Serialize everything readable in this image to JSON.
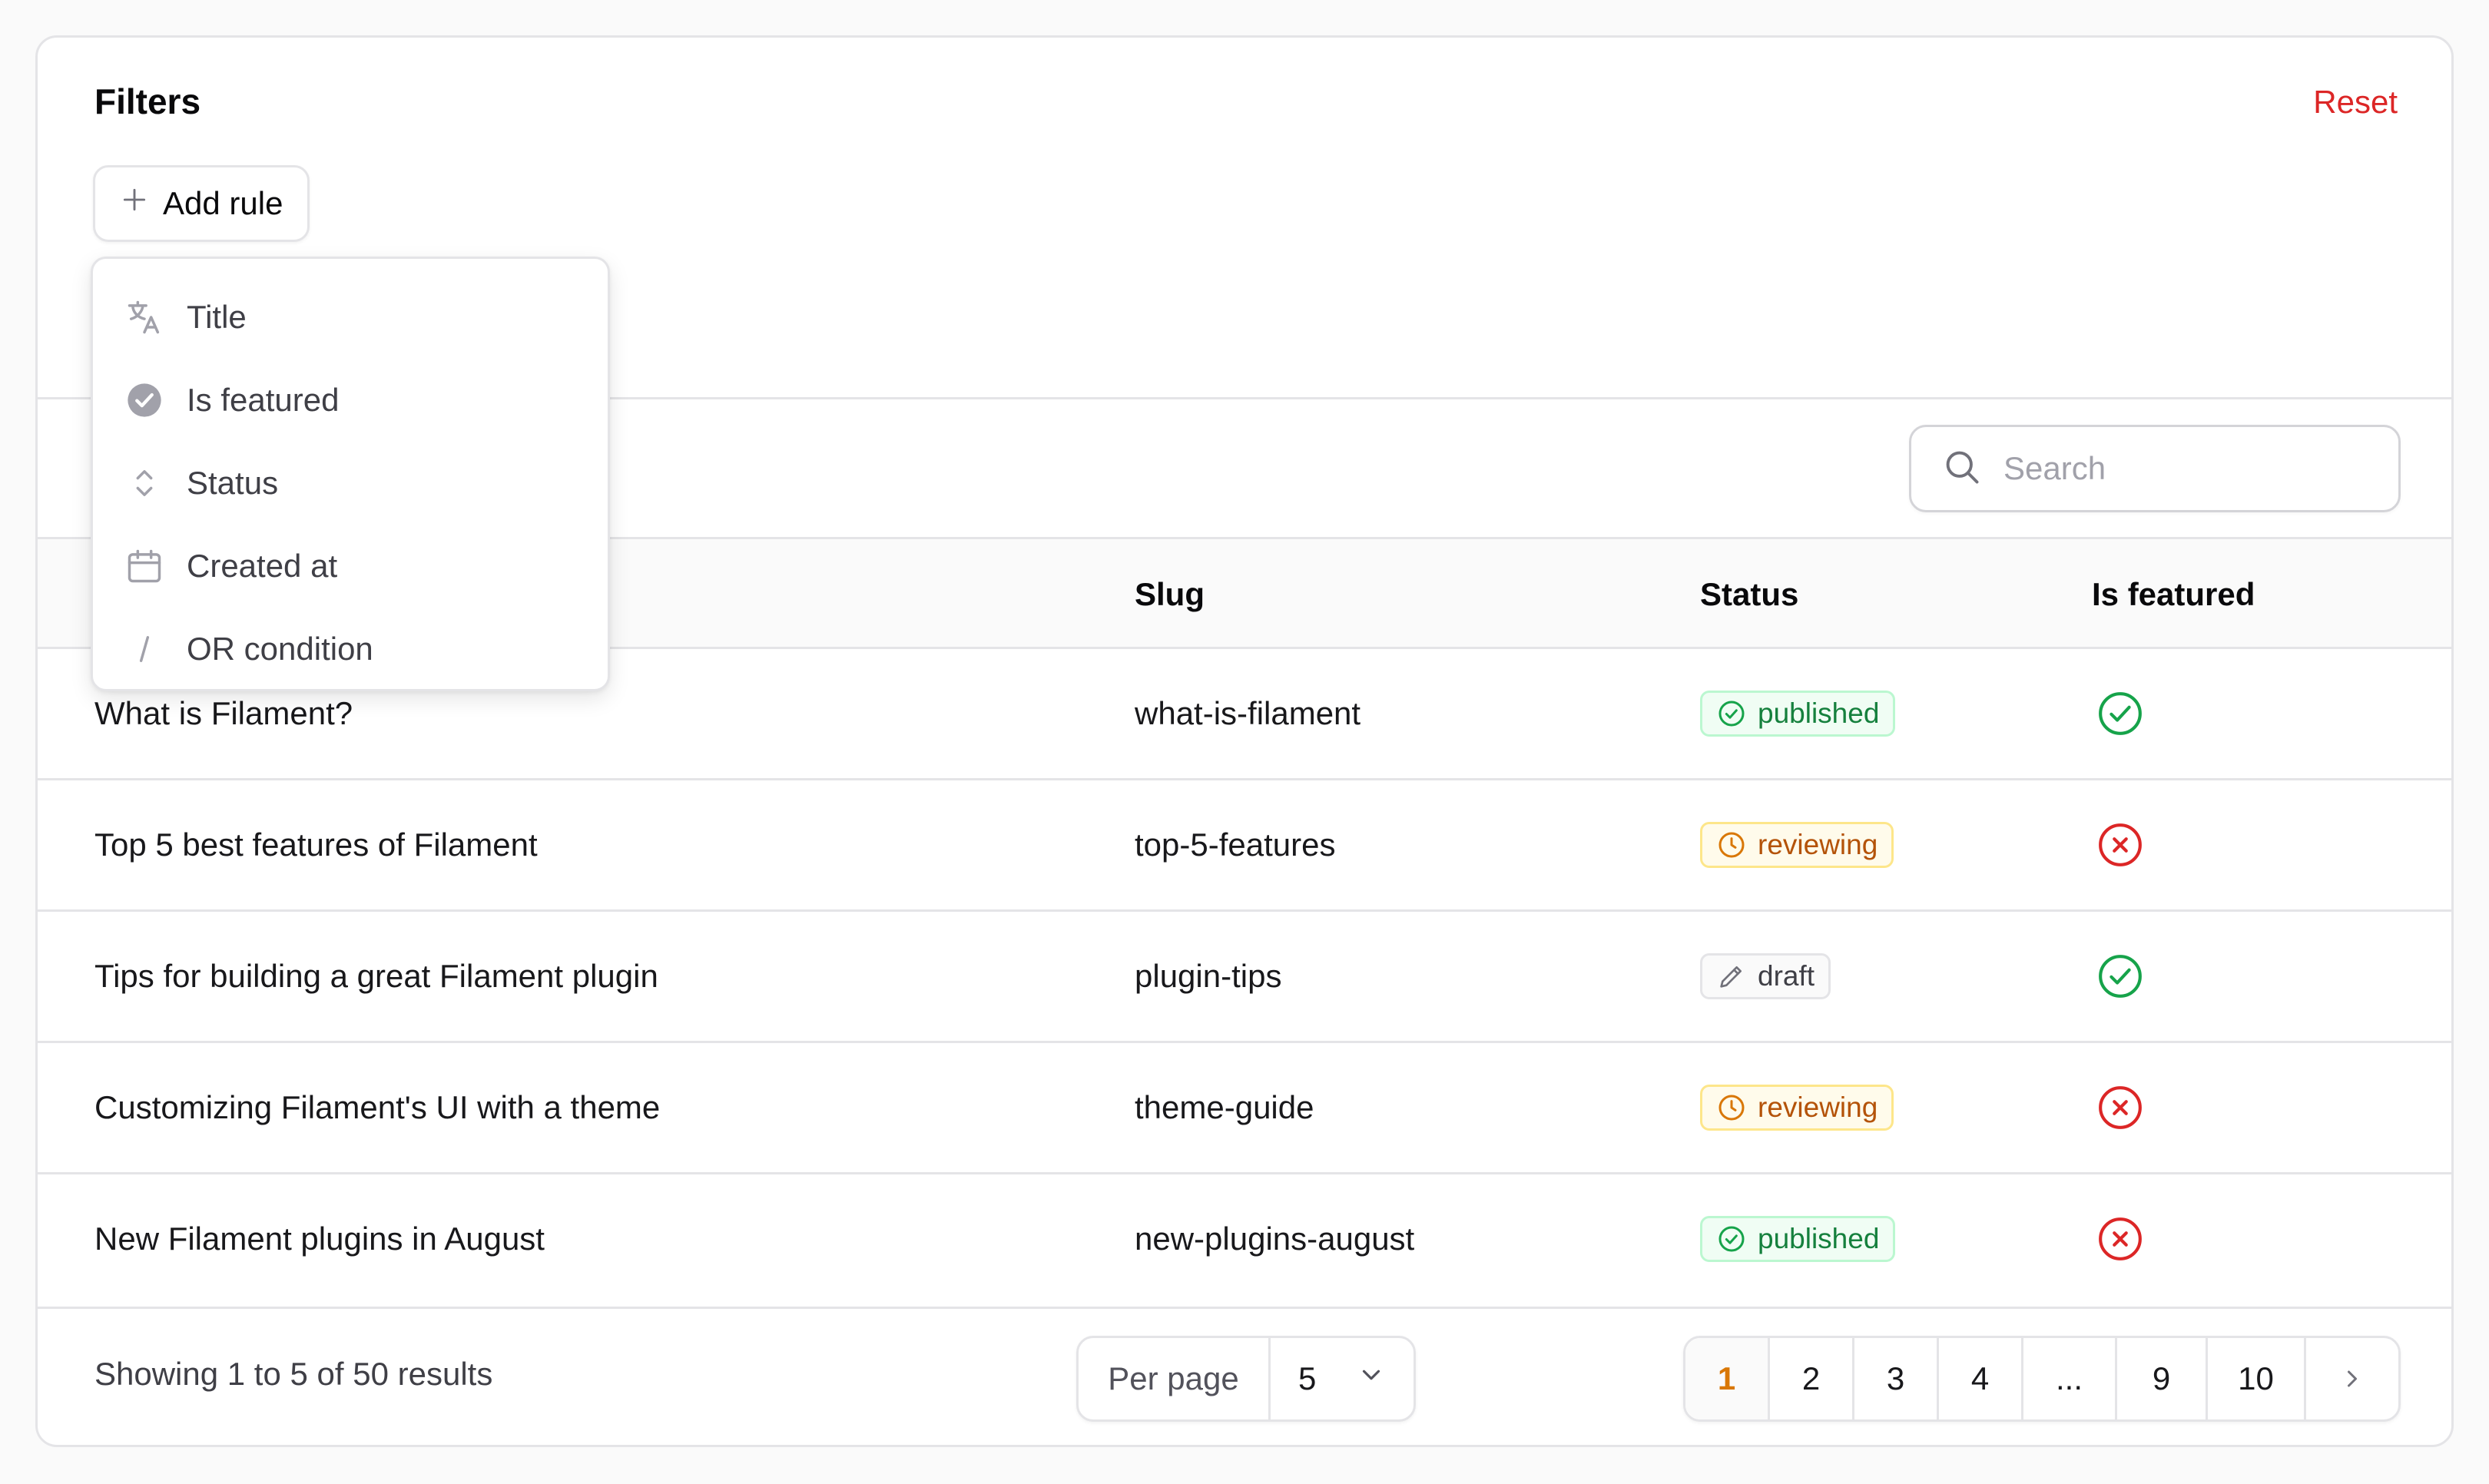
{
  "filters": {
    "title": "Filters",
    "reset_label": "Reset",
    "add_rule_label": "Add rule"
  },
  "rule_menu": {
    "items": [
      {
        "label": "Title",
        "icon": "language-icon"
      },
      {
        "label": "Is featured",
        "icon": "check-circle-icon"
      },
      {
        "label": "Status",
        "icon": "chevron-up-down-icon"
      },
      {
        "label": "Created at",
        "icon": "calendar-icon"
      },
      {
        "label": "OR condition",
        "icon": "slash-icon"
      }
    ]
  },
  "search": {
    "placeholder": "Search",
    "value": ""
  },
  "table": {
    "columns": {
      "slug": "Slug",
      "status": "Status",
      "is_featured": "Is featured"
    },
    "rows": [
      {
        "title": "What is Filament?",
        "slug": "what-is-filament",
        "status": "published",
        "featured": true
      },
      {
        "title": "Top 5 best features of Filament",
        "slug": "top-5-features",
        "status": "reviewing",
        "featured": false
      },
      {
        "title": "Tips for building a great Filament plugin",
        "slug": "plugin-tips",
        "status": "draft",
        "featured": true
      },
      {
        "title": "Customizing Filament's UI with a theme",
        "slug": "theme-guide",
        "status": "reviewing",
        "featured": false
      },
      {
        "title": "New Filament plugins in August",
        "slug": "new-plugins-august",
        "status": "published",
        "featured": false
      }
    ]
  },
  "footer": {
    "showing_text": "Showing 1 to 5 of 50 results",
    "per_page_label": "Per page",
    "per_page_value": "5",
    "pages": [
      "1",
      "2",
      "3",
      "4",
      "...",
      "9",
      "10"
    ],
    "active_page": "1"
  },
  "colors": {
    "accent": "#d97706",
    "danger": "#dc2626",
    "success": "#16a34a"
  }
}
